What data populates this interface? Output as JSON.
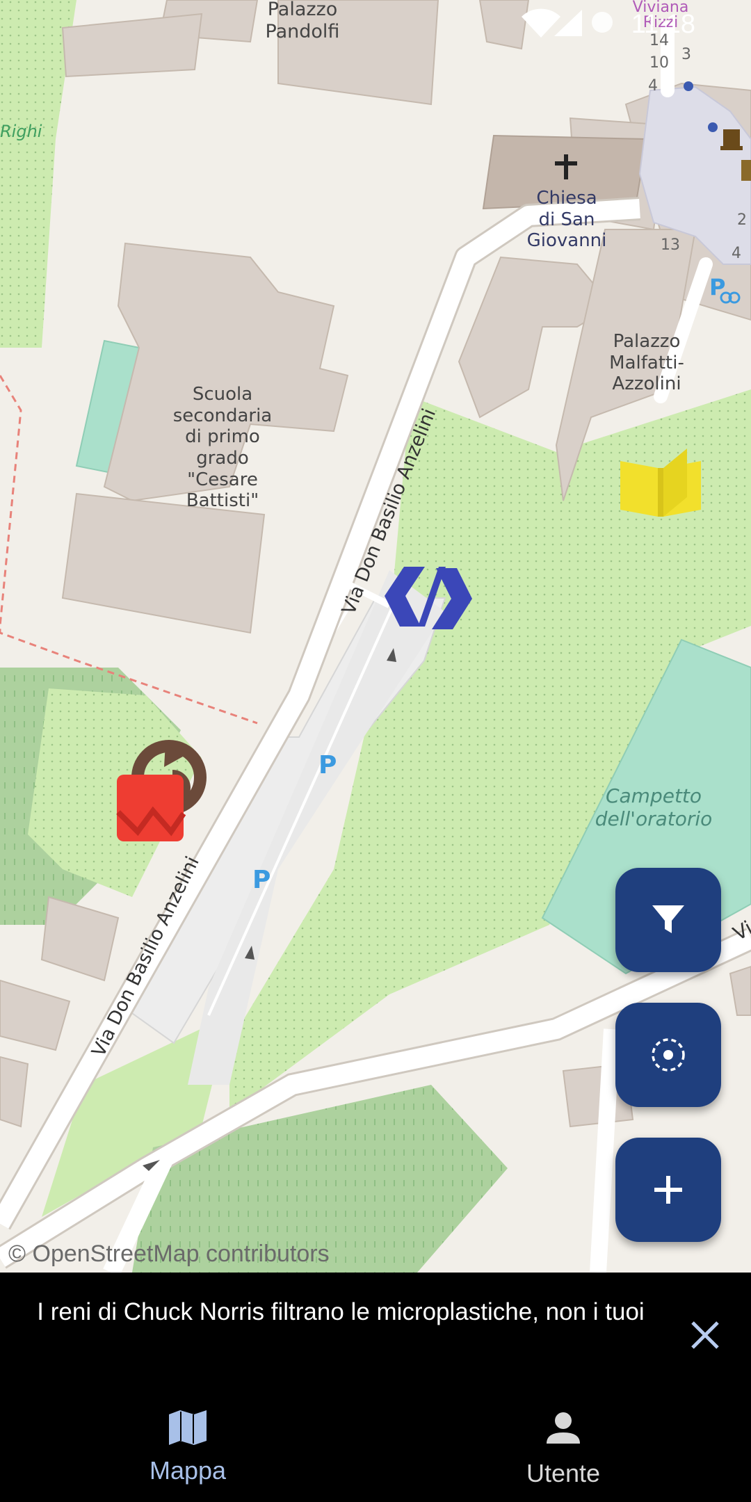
{
  "status_bar": {
    "time": "11:18"
  },
  "map": {
    "attribution": "© OpenStreetMap contributors",
    "labels": {
      "palazzo_pandolfi": "Palazzo\nPandolfi",
      "righi": "Righi",
      "chiesa": "Chiesa\ndi San\nGiovanni",
      "palazzo_malfatti": "Palazzo\nMalfatti-\nAzzolini",
      "scuola": "Scuola\nsecondaria\ndi primo\ngrado\n\"Cesare\nBattisti\"",
      "via_upper": "Via Don Basilio Anzelini",
      "via_lower": "Via Don Basilio Anzelini",
      "campetto": "Campetto\ndell'oratorio",
      "viviana": "Viviana\nRizzi",
      "vi": "Vi",
      "num_14": "14",
      "num_10": "10",
      "num_4": "4",
      "num_3": "3",
      "num_13": "13",
      "num_2": "2",
      "num_4b": "4",
      "parking": "P"
    },
    "markers": [
      "compost-waste-marker",
      "open-book-marker",
      "blue-zigzag-marker"
    ]
  },
  "fabs": {
    "filter": "filter-icon",
    "locate": "my-location-icon",
    "add": "plus-icon"
  },
  "snackbar": {
    "message": "I reni di Chuck Norris filtrano le microplastiche, non i tuoi"
  },
  "bottom_nav": {
    "items": [
      {
        "label": "Mappa",
        "icon": "map-icon",
        "active": true
      },
      {
        "label": "Utente",
        "icon": "person-icon",
        "active": false
      }
    ]
  },
  "colors": {
    "fab_bg": "#1f3f7e",
    "nav_active": "#a8c0e8",
    "nav_inactive": "#d8d8d8",
    "close_icon": "#b8ccf0"
  }
}
